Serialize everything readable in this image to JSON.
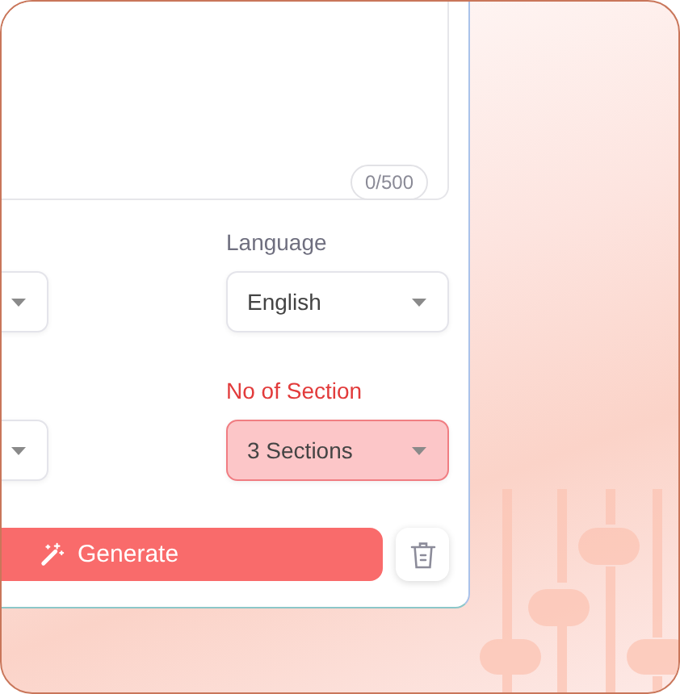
{
  "description": {
    "counter": "0/500"
  },
  "fields": [
    {
      "label": "Language",
      "value": "English",
      "error": false
    },
    {
      "label": "No of Section",
      "value": "3 Sections",
      "error": true
    }
  ],
  "actions": {
    "generate": "Generate"
  }
}
